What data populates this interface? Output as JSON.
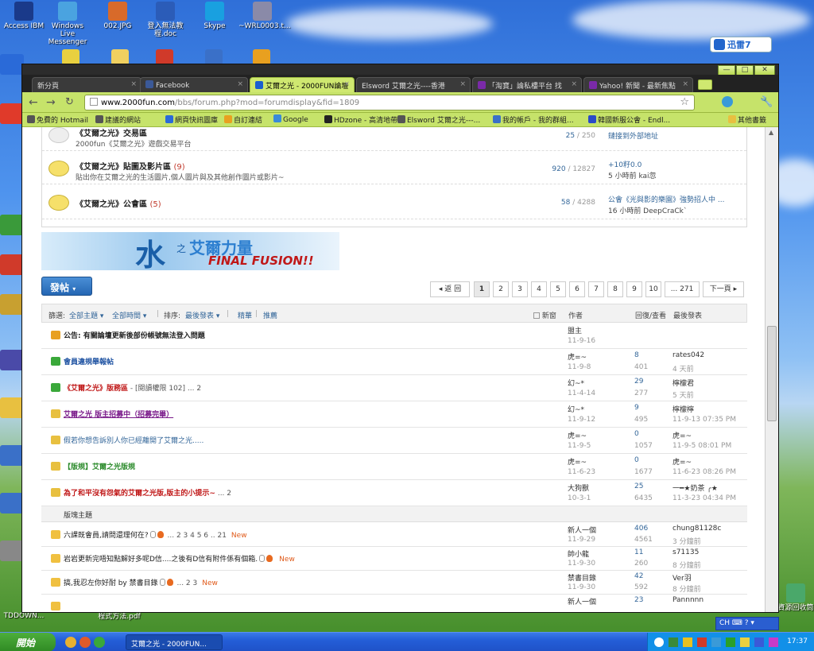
{
  "desktop": {
    "icons": [
      {
        "label": "Access IBM",
        "color": "#1a3a8a"
      },
      {
        "label": "Windows Live Messenger",
        "color": "#4aa3e0"
      },
      {
        "label": "002.JPG",
        "color": "#d86a2a"
      },
      {
        "label": "登入無法教程.doc",
        "color": "#2b5cb8"
      },
      {
        "label": "Skype",
        "color": "#19a0e0"
      },
      {
        "label": "~WRL0003.t...",
        "color": "#8a8aa8"
      }
    ],
    "xunlei_label": "迅雷7",
    "bottom_left_label": "TDDOWN...",
    "bottom_mid_label": "程式方法.pdf",
    "recycle_label": "資源回收筒"
  },
  "browser": {
    "tabs": [
      {
        "label": "新分頁",
        "active": false,
        "icon_color": ""
      },
      {
        "label": "Facebook",
        "active": false,
        "icon_color": "#3b5998"
      },
      {
        "label": "艾爾之光 - 2000FUN論壇",
        "active": true,
        "icon_color": "#1a5fd0"
      },
      {
        "label": "Elsword 艾爾之光----香港",
        "active": false,
        "icon_color": ""
      },
      {
        "label": "「淘寶」論私樓平台 找",
        "active": false,
        "icon_color": "#7a2aa8"
      },
      {
        "label": "Yahoo! 新聞 - 最新焦點",
        "active": false,
        "icon_color": "#7a2aa8"
      }
    ],
    "url_prefix": "www.2000fun.com",
    "url_rest": "/bbs/forum.php?mod=forumdisplay&fid=1809",
    "bookmarks": [
      "免費的 Hotmail",
      "建議的網站",
      "網頁快訊圖庫",
      "自訂連結",
      "Google",
      "HDzone - 高清地帶",
      "Elsword 艾爾之光---...",
      "我的帳戶 - 我的群組...",
      "韓國新服公會 - Endl..."
    ],
    "other_bookmarks": "其他書籤"
  },
  "forum_list": [
    {
      "name": "《艾爾之光》交易區",
      "count": "",
      "desc": "2000fun《艾爾之光》遊戲交易平台",
      "topics": "25",
      "posts": "250",
      "last_title": "鏈接到外部地址",
      "last_info": "",
      "grey": true
    },
    {
      "name": "《艾爾之光》貼圖及影片區",
      "count": "(9)",
      "desc": "貼出你在艾爾之光的生活圖片,個人圖片與及其他創作圖片或影片~",
      "topics": "920",
      "posts": "12827",
      "last_title": "+10籽0.0",
      "last_info": "5 小時前 kai忽",
      "grey": false
    },
    {
      "name": "《艾爾之光》公會區",
      "count": "(5)",
      "desc": "",
      "topics": "58",
      "posts": "4288",
      "last_title": "公會《光與影的樂園》強勢招人中 ...",
      "last_info": "16 小時前 DeepCraCk`",
      "grey": false
    }
  ],
  "banner": {
    "shui": "水",
    "zhi": "之",
    "ai": "艾爾力量",
    "ff": "FINAL FUSION!!"
  },
  "post_button": "發帖",
  "pager": {
    "prev": "◂ 返 回",
    "pages": [
      "1",
      "2",
      "3",
      "4",
      "5",
      "6",
      "7",
      "8",
      "9",
      "10",
      "... 271"
    ],
    "next": "下一頁 ▸"
  },
  "filter": {
    "label": "篩選:",
    "all_topics": "全部主題",
    "all_time": "全部時間",
    "sort_label": "排序:",
    "sort": "最後發表",
    "digest": "精華",
    "recommend": "推薦",
    "new_window": "新窗",
    "col_author": "作者",
    "col_replies": "回復/查看",
    "col_last": "最後發表"
  },
  "threads": [
    {
      "title": "公告: 有關論壇更新後部份帳號無法登入問題",
      "tail": "",
      "color": "#222",
      "bold": true,
      "underline": false,
      "icon": "announce",
      "author": "盟主",
      "date": "11-9-16",
      "replies": "",
      "views": "",
      "last_user": "",
      "last_time": ""
    },
    {
      "title": "會員違規舉報帖",
      "tail": "",
      "color": "#1a4fa0",
      "bold": true,
      "underline": false,
      "icon": "up",
      "author": "虎=~",
      "date": "11-9-8",
      "replies": "8",
      "views": "401",
      "last_user": "rates042",
      "last_time": "4 天前"
    },
    {
      "title": "《艾爾之光》版務區",
      "tail": " - [閱讀權限 102] ... 2",
      "color": "#c01818",
      "bold": true,
      "underline": false,
      "icon": "up",
      "author": "幻~*",
      "date": "11-4-14",
      "replies": "29",
      "views": "277",
      "last_user": "檸檬君",
      "last_time": "5 天前"
    },
    {
      "title": "艾爾之光 版主招募中（招募完畢）",
      "tail": "",
      "color": "#7a1a8a",
      "bold": true,
      "underline": true,
      "icon": "lock",
      "author": "幻~*",
      "date": "11-9-12",
      "replies": "9",
      "views": "495",
      "last_user": "檸檬檸",
      "last_time": "11-9-13 07:35 PM"
    },
    {
      "title": "假若你想告訴別人你已經離開了艾爾之光.....",
      "tail": "",
      "color": "#336699",
      "bold": false,
      "underline": false,
      "icon": "lock",
      "author": "虎=~",
      "date": "11-9-5",
      "replies": "0",
      "views": "1057",
      "last_user": "虎=~",
      "last_time": "11-9-5 08:01 PM"
    },
    {
      "title": "【版規】艾爾之光版規",
      "tail": "",
      "color": "#2a8a2a",
      "bold": true,
      "underline": false,
      "icon": "lock",
      "author": "虎=~",
      "date": "11-6-23",
      "replies": "0",
      "views": "1677",
      "last_user": "虎=~",
      "last_time": "11-6-23 08:26 PM"
    },
    {
      "title": "為了和平沒有怨氣的艾爾之光版,版主的小提示~",
      "tail": " ... 2",
      "color": "#c01818",
      "bold": true,
      "underline": false,
      "icon": "lock",
      "author": "大狗獸",
      "date": "10-3-1",
      "replies": "25",
      "views": "6435",
      "last_user": "一━★奶茶 ╭★",
      "last_time": "11-3-23 04:34 PM"
    }
  ],
  "section_label": "版塊主題",
  "threads2": [
    {
      "title": "六課既會員,請問還理何在?",
      "tail": " ... 2 3 4 5 6 .. 21",
      "new": "New",
      "author": "新人一個",
      "date": "11-9-29",
      "replies": "406",
      "views": "4561",
      "last_user": "chung81128c",
      "last_time": "3 分鐘前"
    },
    {
      "title": "岩岩更新完唔知點解好多呢D信....之後有D信有附件係有個箱.",
      "tail": "",
      "new": "New",
      "author": "帥小龍",
      "date": "11-9-30",
      "replies": "11",
      "views": "260",
      "last_user": "s71135",
      "last_time": "8 分鐘前"
    },
    {
      "title": "搞,我忍左你好耐 by 禁書目錄",
      "tail": " ... 2 3",
      "new": "New",
      "author": "禁書目錄",
      "date": "11-9-30",
      "replies": "42",
      "views": "592",
      "last_user": "Ver羽",
      "last_time": "8 分鐘前"
    },
    {
      "title": "",
      "tail": "",
      "new": "",
      "author": "新人一個",
      "date": "",
      "replies": "23",
      "views": "",
      "last_user": "Pannnnn",
      "last_time": ""
    }
  ],
  "taskbar": {
    "start": "開始",
    "task": "艾爾之光 - 2000FUN...",
    "clock": "17:37",
    "lang": "CH"
  }
}
